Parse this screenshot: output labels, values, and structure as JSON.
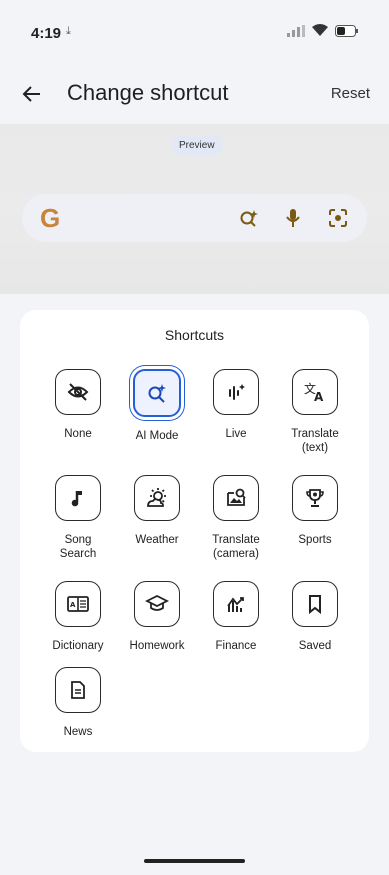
{
  "status_bar": {
    "time": "4:19"
  },
  "app_bar": {
    "title": "Change shortcut",
    "reset_label": "Reset"
  },
  "preview": {
    "chip_label": "Preview",
    "logo_letter": "G"
  },
  "shortcuts": {
    "title": "Shortcuts",
    "selected": "AI Mode",
    "items": [
      {
        "label": "None",
        "icon": "eye-off-icon"
      },
      {
        "label": "AI Mode",
        "icon": "ai-search-icon"
      },
      {
        "label": "Live",
        "icon": "live-wave-icon"
      },
      {
        "label": "Translate\n(text)",
        "icon": "translate-icon"
      },
      {
        "label": "Song\nSearch",
        "icon": "music-note-icon"
      },
      {
        "label": "Weather",
        "icon": "weather-icon"
      },
      {
        "label": "Translate\n(camera)",
        "icon": "camera-translate-icon"
      },
      {
        "label": "Sports",
        "icon": "trophy-icon"
      },
      {
        "label": "Dictionary",
        "icon": "dictionary-icon"
      },
      {
        "label": "Homework",
        "icon": "graduation-cap-icon"
      },
      {
        "label": "Finance",
        "icon": "finance-chart-icon"
      },
      {
        "label": "Saved",
        "icon": "bookmark-icon"
      },
      {
        "label": "News",
        "icon": "news-icon"
      }
    ]
  },
  "colors": {
    "accent": "#2360d8",
    "sheet": "#ffffff",
    "background": "#f3f4f8"
  }
}
